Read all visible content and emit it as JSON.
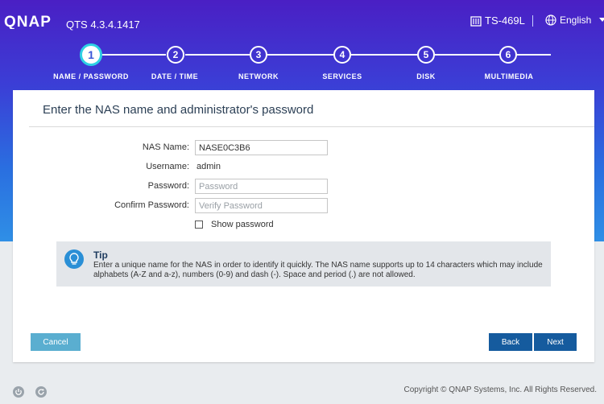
{
  "header": {
    "brand": "QNAP",
    "version": "QTS 4.3.4.1417",
    "model": "TS-469L",
    "language": "English"
  },
  "steps": [
    {
      "number": "1",
      "label": "NAME / PASSWORD"
    },
    {
      "number": "2",
      "label": "DATE / TIME"
    },
    {
      "number": "3",
      "label": "NETWORK"
    },
    {
      "number": "4",
      "label": "SERVICES"
    },
    {
      "number": "5",
      "label": "DISK"
    },
    {
      "number": "6",
      "label": "MULTIMEDIA"
    }
  ],
  "form": {
    "title": "Enter the NAS name and administrator's password",
    "nas_name_label": "NAS Name:",
    "nas_name_value": "NASE0C3B6",
    "username_label": "Username:",
    "username_value": "admin",
    "password_label": "Password:",
    "password_placeholder": "Password",
    "confirm_label": "Confirm Password:",
    "confirm_placeholder": "Verify Password",
    "show_password_label": "Show password"
  },
  "tip": {
    "title": "Tip",
    "text": "Enter a unique name for the NAS in order to identify it quickly. The NAS name supports up to 14 characters which may include alphabets (A-Z and a-z), numbers (0-9) and dash (-). Space and period (.) are not allowed."
  },
  "buttons": {
    "cancel": "Cancel",
    "back": "Back",
    "next": "Next"
  },
  "footer": {
    "copyright": "Copyright © QNAP Systems, Inc. All Rights Reserved."
  },
  "colors": {
    "accent": "#155b9e",
    "cancel": "#5aaed0",
    "active_ring": "#2fd0e4"
  }
}
